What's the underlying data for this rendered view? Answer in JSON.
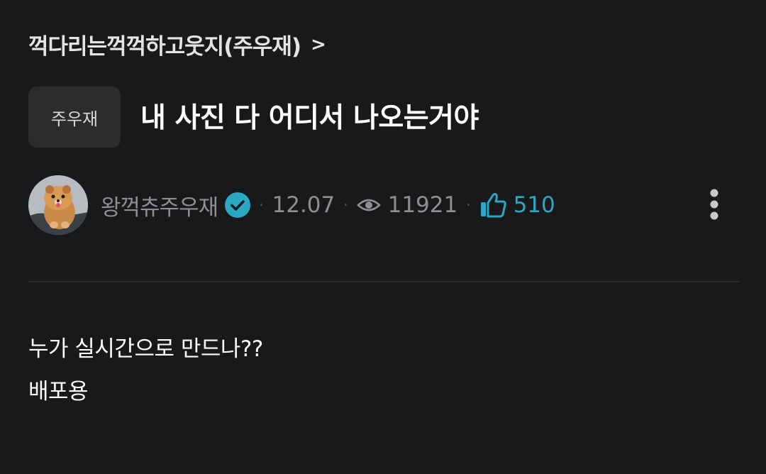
{
  "board": {
    "name": "꺽다리는꺽꺽하고웃지(주우재)",
    "chevron": ">"
  },
  "post": {
    "tag": "주우재",
    "title": "내 사진 다 어디서 나오는거야",
    "author": "왕꺽츄주우재",
    "date": "12.07",
    "views": "11921",
    "likes": "510",
    "body": [
      "누가 실시간으로 만드나??",
      "배포용"
    ]
  },
  "icons": {
    "avatar": "dog-avatar",
    "verified": "verified-check-icon",
    "views": "eye-icon",
    "likes": "thumbs-up-icon",
    "more": "more-vertical-icon"
  },
  "colors": {
    "background": "#19191b",
    "accent": "#2aa8c4",
    "muted_text": "#8e8e93",
    "tag_bg": "#2c2c2f"
  }
}
